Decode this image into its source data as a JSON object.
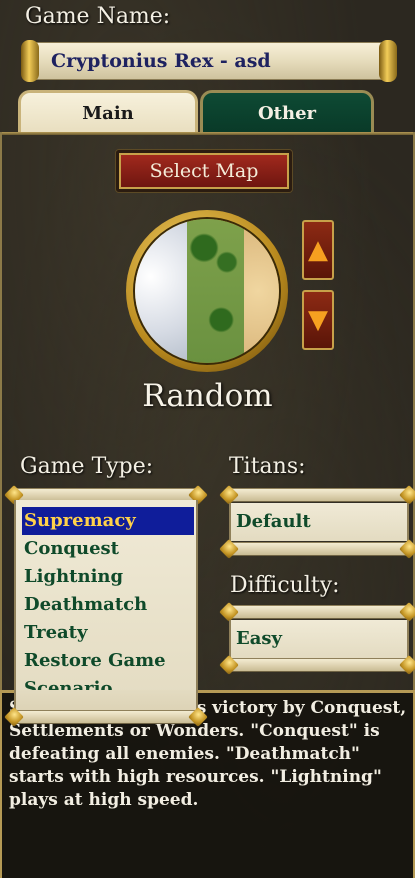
{
  "game_name": {
    "label": "Game Name:",
    "value": "Cryptonius Rex - asd"
  },
  "tabs": [
    {
      "label": "Main",
      "active": true
    },
    {
      "label": "Other",
      "active": false
    }
  ],
  "map": {
    "select_label": "Select Map",
    "name": "Random",
    "up_icon": "arrow-up-icon",
    "down_icon": "arrow-down-icon"
  },
  "game_type": {
    "label": "Game Type:",
    "options": [
      "Supremacy",
      "Conquest",
      "Lightning",
      "Deathmatch",
      "Treaty",
      "Restore Game",
      "Scenario"
    ],
    "selected": "Supremacy"
  },
  "titans": {
    "label": "Titans:",
    "value": "Default"
  },
  "difficulty": {
    "label": "Difficulty:",
    "value": "Easy"
  },
  "description": {
    "text": "S...e. \"Supremacy\" is victory by Conquest, Settlements or Wonders. \"Conquest\" is defeating all enemies. \"Deathmatch\" starts with high resources. \"Lightning\" plays at high speed."
  },
  "colors": {
    "selected_bg": "#0f1d9a",
    "selected_text": "#ffd24a",
    "list_text": "#0f4a2a",
    "name_text": "#1e2260"
  }
}
